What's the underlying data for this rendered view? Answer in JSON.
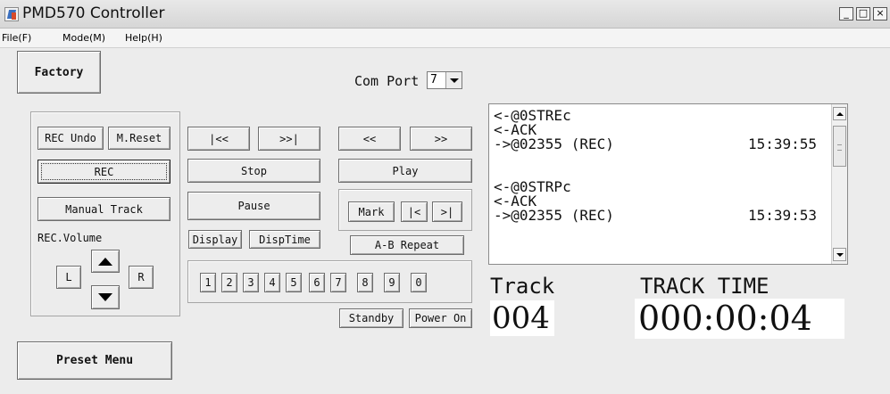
{
  "window": {
    "title": "PMD570 Controller",
    "controls": {
      "minimize": "_",
      "maximize": "□",
      "close": "×"
    }
  },
  "menu": [
    "File(F)",
    "Mode(M)",
    "Help(H)"
  ],
  "factory_button": "Factory",
  "com_port": {
    "label": "Com Port",
    "value": "7"
  },
  "rec_group": {
    "rec_undo": "REC Undo",
    "m_reset": "M.Reset",
    "rec": "REC",
    "manual_track": "Manual Track",
    "volume_label": "REC.Volume",
    "left": "L",
    "right": "R"
  },
  "transport": {
    "skip_back": "|<<",
    "skip_fwd": ">>|",
    "rewind": "<<",
    "fast_fwd": ">>",
    "stop": "Stop",
    "play": "Play",
    "pause": "Pause",
    "mark": "Mark",
    "mark_prev": "|<",
    "mark_next": ">|",
    "display": "Display",
    "disp_time": "DispTime",
    "ab_repeat": "A-B Repeat",
    "keypad": [
      "1",
      "2",
      "3",
      "4",
      "5",
      "6",
      "7",
      "8",
      "9",
      "0"
    ],
    "standby": "Standby",
    "power_on": "Power On"
  },
  "preset_menu_button": "Preset Menu",
  "log": {
    "lines": [
      "<-@0STREc",
      "<-ACK",
      "->@02355 (REC)",
      "",
      "<-@0STRPc",
      "<-ACK",
      "->@02355 (REC)"
    ],
    "times": {
      "2": "15:39:55",
      "6": "15:39:53"
    }
  },
  "track": {
    "label": "Track",
    "value": "004"
  },
  "track_time": {
    "label": "TRACK TIME",
    "value": "000:00:04"
  }
}
